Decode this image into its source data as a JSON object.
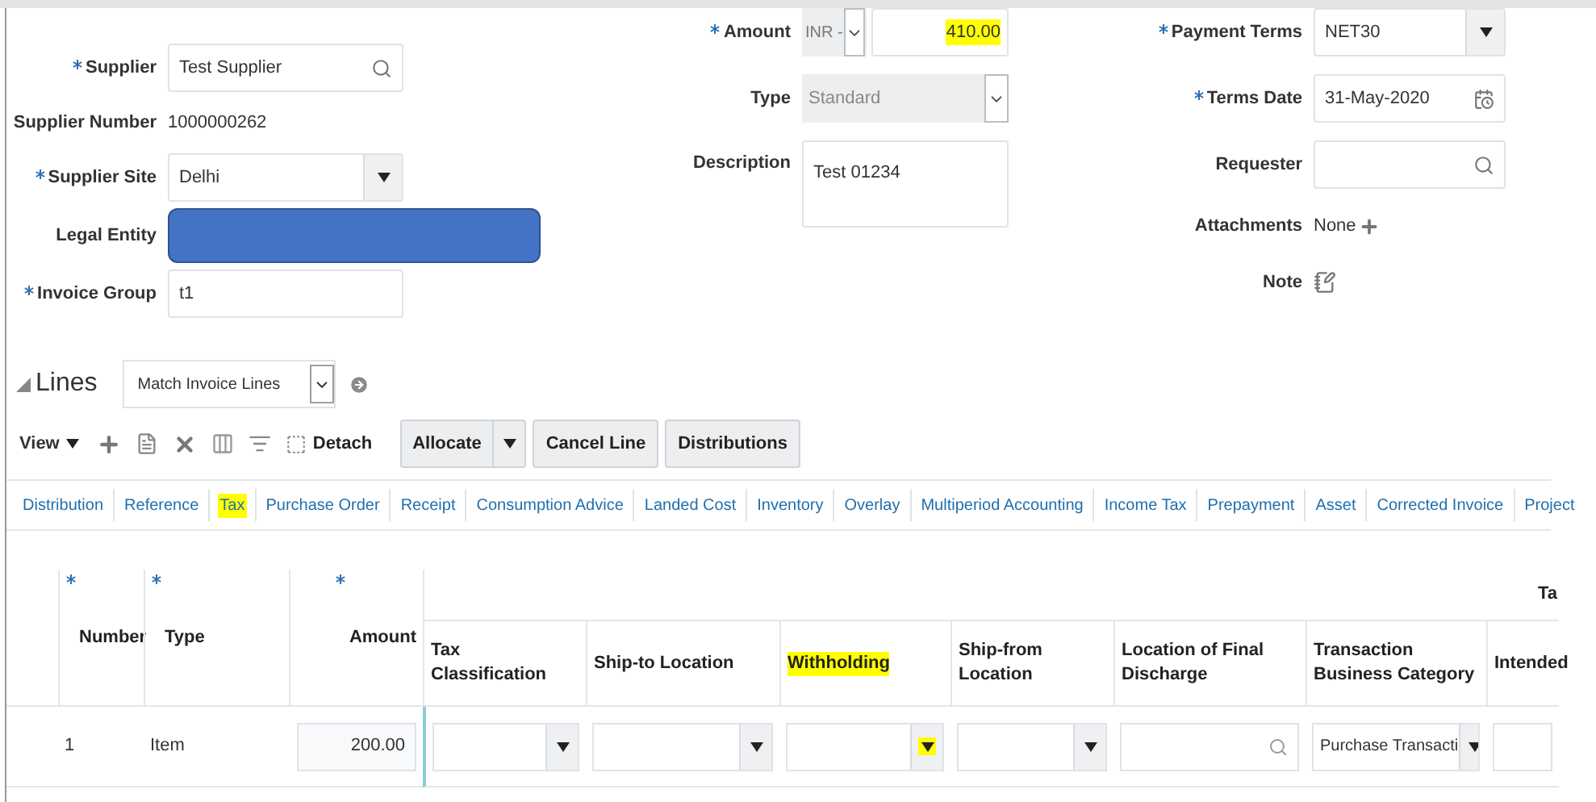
{
  "form": {
    "column_1": [
      {
        "kind": "search",
        "label": "Supplier",
        "required": true,
        "value": "Test Supplier"
      },
      {
        "kind": "text",
        "label": "Supplier Number",
        "required": false,
        "value": "1000000262"
      },
      {
        "kind": "select",
        "label": "Supplier Site",
        "required": true,
        "value": "Delhi"
      },
      {
        "kind": "redacted",
        "label": "Legal Entity",
        "required": false
      },
      {
        "kind": "field",
        "label": "Invoice Group",
        "required": true,
        "value": "t1"
      }
    ],
    "column_2": [
      {
        "kind": "currency",
        "label": "Amount",
        "required": true,
        "currency": "INR -",
        "value": "410.00",
        "highlighted": true
      },
      {
        "kind": "choice",
        "label": "Type",
        "required": false,
        "value": "Standard",
        "disabled": true
      },
      {
        "kind": "textarea",
        "label": "Description",
        "required": false,
        "value": "Test 01234"
      }
    ],
    "column_3": [
      {
        "kind": "select",
        "label": "Payment Terms",
        "required": true,
        "value": "NET30"
      },
      {
        "kind": "date",
        "label": "Terms Date",
        "required": true,
        "value": "31-May-2020"
      },
      {
        "kind": "search",
        "label": "Requester",
        "required": false
      },
      {
        "kind": "attachments",
        "label": "Attachments",
        "required": false,
        "value": "None"
      },
      {
        "kind": "note",
        "label": "Note",
        "required": false
      }
    ]
  },
  "lines": {
    "title": "Lines",
    "expanded": true,
    "match_select": "Match Invoice Lines",
    "toolbar": {
      "view_menu": "View",
      "detach": "Detach",
      "buttons": [
        {
          "label": "Allocate",
          "kind": "split"
        },
        {
          "label": "Cancel Line",
          "kind": "plain"
        },
        {
          "label": "Distributions",
          "kind": "plain"
        }
      ]
    },
    "tabs": [
      {
        "label": "Distribution",
        "highlighted": false
      },
      {
        "label": "Reference",
        "highlighted": false
      },
      {
        "label": "Tax",
        "highlighted": true
      },
      {
        "label": "Purchase Order",
        "highlighted": false
      },
      {
        "label": "Receipt",
        "highlighted": false
      },
      {
        "label": "Consumption Advice",
        "highlighted": false
      },
      {
        "label": "Landed Cost",
        "highlighted": false
      },
      {
        "label": "Inventory",
        "highlighted": false
      },
      {
        "label": "Overlay",
        "highlighted": false
      },
      {
        "label": "Multiperiod Accounting",
        "highlighted": false
      },
      {
        "label": "Income Tax",
        "highlighted": false
      },
      {
        "label": "Prepayment",
        "highlighted": false
      },
      {
        "label": "Asset",
        "highlighted": false
      },
      {
        "label": "Corrected Invoice",
        "highlighted": false
      },
      {
        "label": "Project",
        "highlighted": false
      }
    ],
    "table": {
      "group_header": "Ta",
      "columns": [
        {
          "label": "Number",
          "required": true,
          "highlighted": false
        },
        {
          "label": "Type",
          "required": true,
          "highlighted": false
        },
        {
          "label": "Amount",
          "required": true,
          "highlighted": false
        },
        {
          "label": "Tax Classification",
          "required": false,
          "highlighted": false
        },
        {
          "label": "Ship-to Location",
          "required": false,
          "highlighted": false
        },
        {
          "label": "Withholding",
          "required": false,
          "highlighted": true
        },
        {
          "label": "Ship-from Location",
          "required": false,
          "highlighted": false
        },
        {
          "label": "Location of Final Discharge",
          "required": false,
          "highlighted": false
        },
        {
          "label": "Transaction Business Category",
          "required": false,
          "highlighted": false
        },
        {
          "label": "Intended",
          "required": false,
          "highlighted": false
        }
      ],
      "rows": [
        {
          "cells": [
            {
              "kind": "text",
              "value": "1"
            },
            {
              "kind": "text",
              "value": "Item"
            },
            {
              "kind": "amount",
              "value": "200.00"
            },
            {
              "kind": "select",
              "highlighted": false
            },
            {
              "kind": "select",
              "highlighted": false
            },
            {
              "kind": "select",
              "highlighted": true
            },
            {
              "kind": "select",
              "highlighted": false
            },
            {
              "kind": "search"
            },
            {
              "kind": "select",
              "value": "Purchase Transacti",
              "highlighted": false
            },
            {
              "kind": "field"
            }
          ]
        }
      ]
    }
  }
}
